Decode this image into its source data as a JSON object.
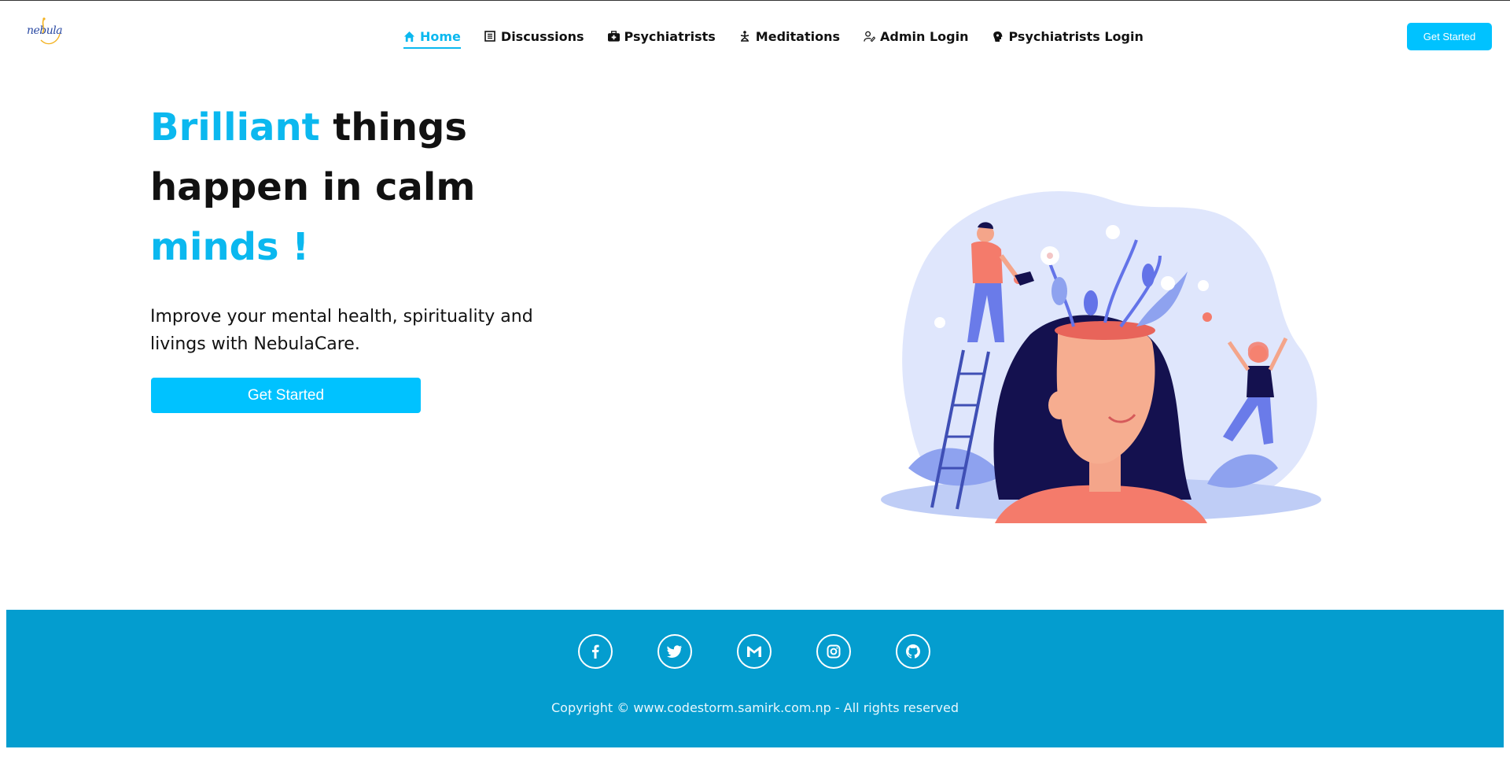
{
  "header": {
    "logo_text": "nebula",
    "nav": [
      {
        "label": "Home",
        "icon": "home-icon",
        "active": true
      },
      {
        "label": "Discussions",
        "icon": "list-icon",
        "active": false
      },
      {
        "label": "Psychiatrists",
        "icon": "medkit-icon",
        "active": false
      },
      {
        "label": "Meditations",
        "icon": "meditation-icon",
        "active": false
      },
      {
        "label": "Admin Login",
        "icon": "user-edit-icon",
        "active": false
      },
      {
        "label": "Psychiatrists Login",
        "icon": "brain-icon",
        "active": false
      }
    ],
    "cta_label": "Get Started"
  },
  "hero": {
    "title_part1": "Brilliant",
    "title_part2": " things happen in calm ",
    "title_part3": "minds !",
    "subtitle": "Improve your mental health, spirituality and livings with NebulaCare.",
    "cta_label": "Get Started"
  },
  "footer": {
    "socials": [
      "facebook-icon",
      "twitter-icon",
      "gmail-icon",
      "instagram-icon",
      "github-icon"
    ],
    "copyright": "Copyright © www.codestorm.samirk.com.np - All rights reserved"
  },
  "colors": {
    "accent": "#0bb8ef",
    "button": "#00c2ff",
    "footer": "#049dcf"
  }
}
